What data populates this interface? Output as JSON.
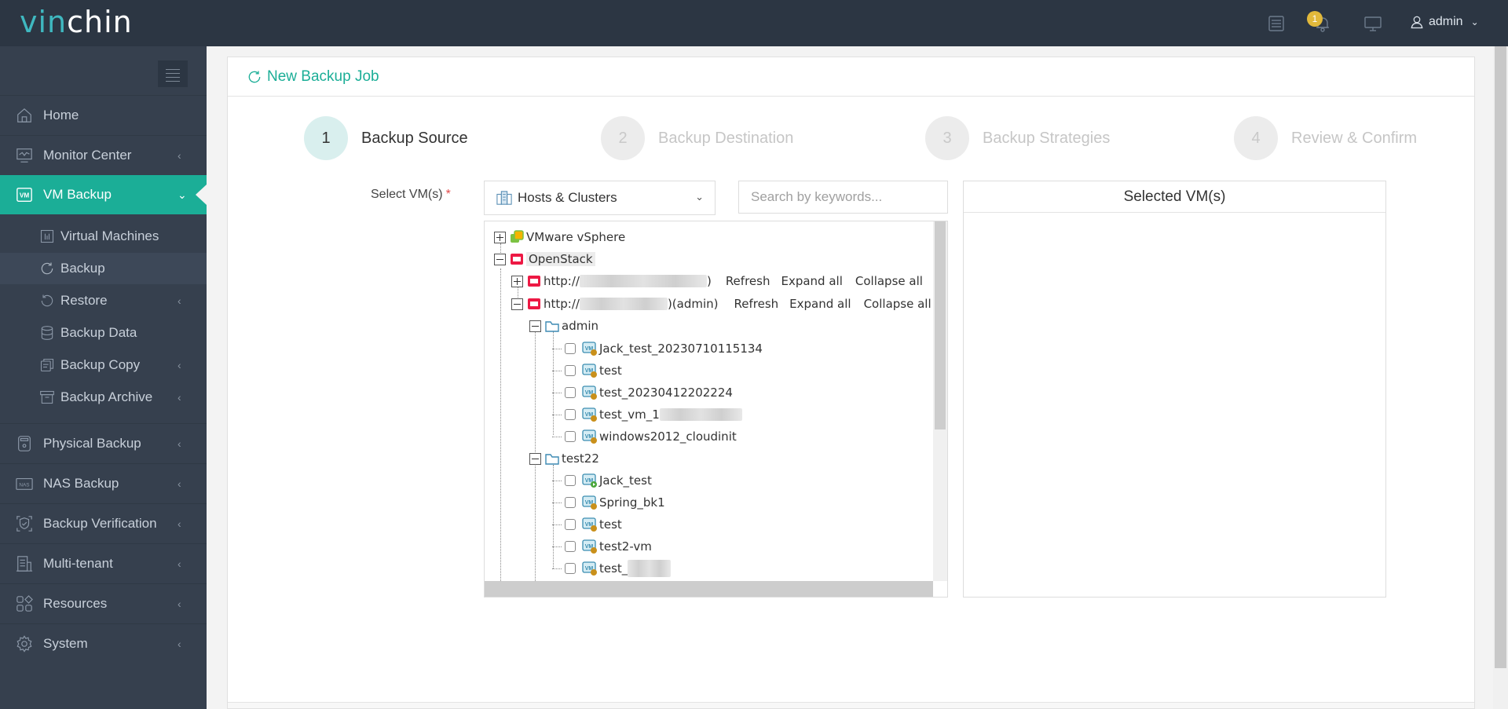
{
  "header": {
    "logo_part1": "vin",
    "logo_part2": "chin",
    "notification_count": "1",
    "user_name": "admin",
    "icons": [
      "task-list-icon",
      "bell-icon",
      "monitor-icon",
      "user-icon"
    ]
  },
  "sidebar": {
    "items": [
      {
        "label": "Home",
        "icon": "home-icon",
        "has_children": false
      },
      {
        "label": "Monitor Center",
        "icon": "monitor-center-icon",
        "has_children": true
      },
      {
        "label": "VM Backup",
        "icon": "vm-icon",
        "has_children": true,
        "active": true
      },
      {
        "label": "Physical Backup",
        "icon": "physical-server-icon",
        "has_children": true
      },
      {
        "label": "NAS Backup",
        "icon": "nas-icon",
        "has_children": true
      },
      {
        "label": "Backup Verification",
        "icon": "shield-check-icon",
        "has_children": true
      },
      {
        "label": "Multi-tenant",
        "icon": "building-icon",
        "has_children": true
      },
      {
        "label": "Resources",
        "icon": "resources-icon",
        "has_children": true
      },
      {
        "label": "System",
        "icon": "gear-icon",
        "has_children": true
      }
    ],
    "vm_backup_sub": [
      {
        "label": "Virtual Machines",
        "icon": "virtual-machines-icon",
        "has_children": false
      },
      {
        "label": "Backup",
        "icon": "backup-icon",
        "has_children": false,
        "current": true
      },
      {
        "label": "Restore",
        "icon": "restore-icon",
        "has_children": true
      },
      {
        "label": "Backup Data",
        "icon": "database-icon",
        "has_children": false
      },
      {
        "label": "Backup Copy",
        "icon": "copy-icon",
        "has_children": true
      },
      {
        "label": "Backup Archive",
        "icon": "archive-icon",
        "has_children": true
      }
    ]
  },
  "page": {
    "title": "New Backup Job",
    "steps": [
      {
        "num": "1",
        "label": "Backup Source",
        "active": true
      },
      {
        "num": "2",
        "label": "Backup Destination",
        "active": false
      },
      {
        "num": "3",
        "label": "Backup Strategies",
        "active": false
      },
      {
        "num": "4",
        "label": "Review & Confirm",
        "active": false
      }
    ],
    "select_label": "Select VM(s)",
    "required_mark": "*",
    "view_dropdown": "Hosts & Clusters",
    "search_placeholder": "Search by keywords...",
    "selected_panel_title": "Selected VM(s)"
  },
  "tree": {
    "vsphere": "VMware vSphere",
    "openstack": "OpenStack",
    "host1_prefix": "http://",
    "host1_suffix": ")",
    "host2_prefix": "http://",
    "host2_suffix": ")(admin)",
    "refresh": "Refresh",
    "expand_all": "Expand all",
    "collapse_all": "Collapse all",
    "project_admin": "admin",
    "admin_vms": [
      {
        "name": "Jack_test_20230710115134",
        "state": "suspended"
      },
      {
        "name": "test",
        "state": "suspended"
      },
      {
        "name": "test_20230412202224",
        "state": "suspended"
      },
      {
        "name": "test_vm_1",
        "state": "suspended",
        "redacted": true
      },
      {
        "name": "windows2012_cloudinit",
        "state": "suspended"
      }
    ],
    "project_test22": "test22",
    "test22_vms": [
      {
        "name": "Jack_test",
        "state": "running"
      },
      {
        "name": "Spring_bk1",
        "state": "suspended"
      },
      {
        "name": "test",
        "state": "suspended"
      },
      {
        "name": "test2-vm",
        "state": "suspended"
      },
      {
        "name": "test_",
        "state": "suspended",
        "redacted": true
      }
    ]
  },
  "colors": {
    "accent": "#1bae97",
    "header_bg": "#2c3643",
    "sidebar_bg": "#36404e",
    "badge": "#e2b93b"
  }
}
